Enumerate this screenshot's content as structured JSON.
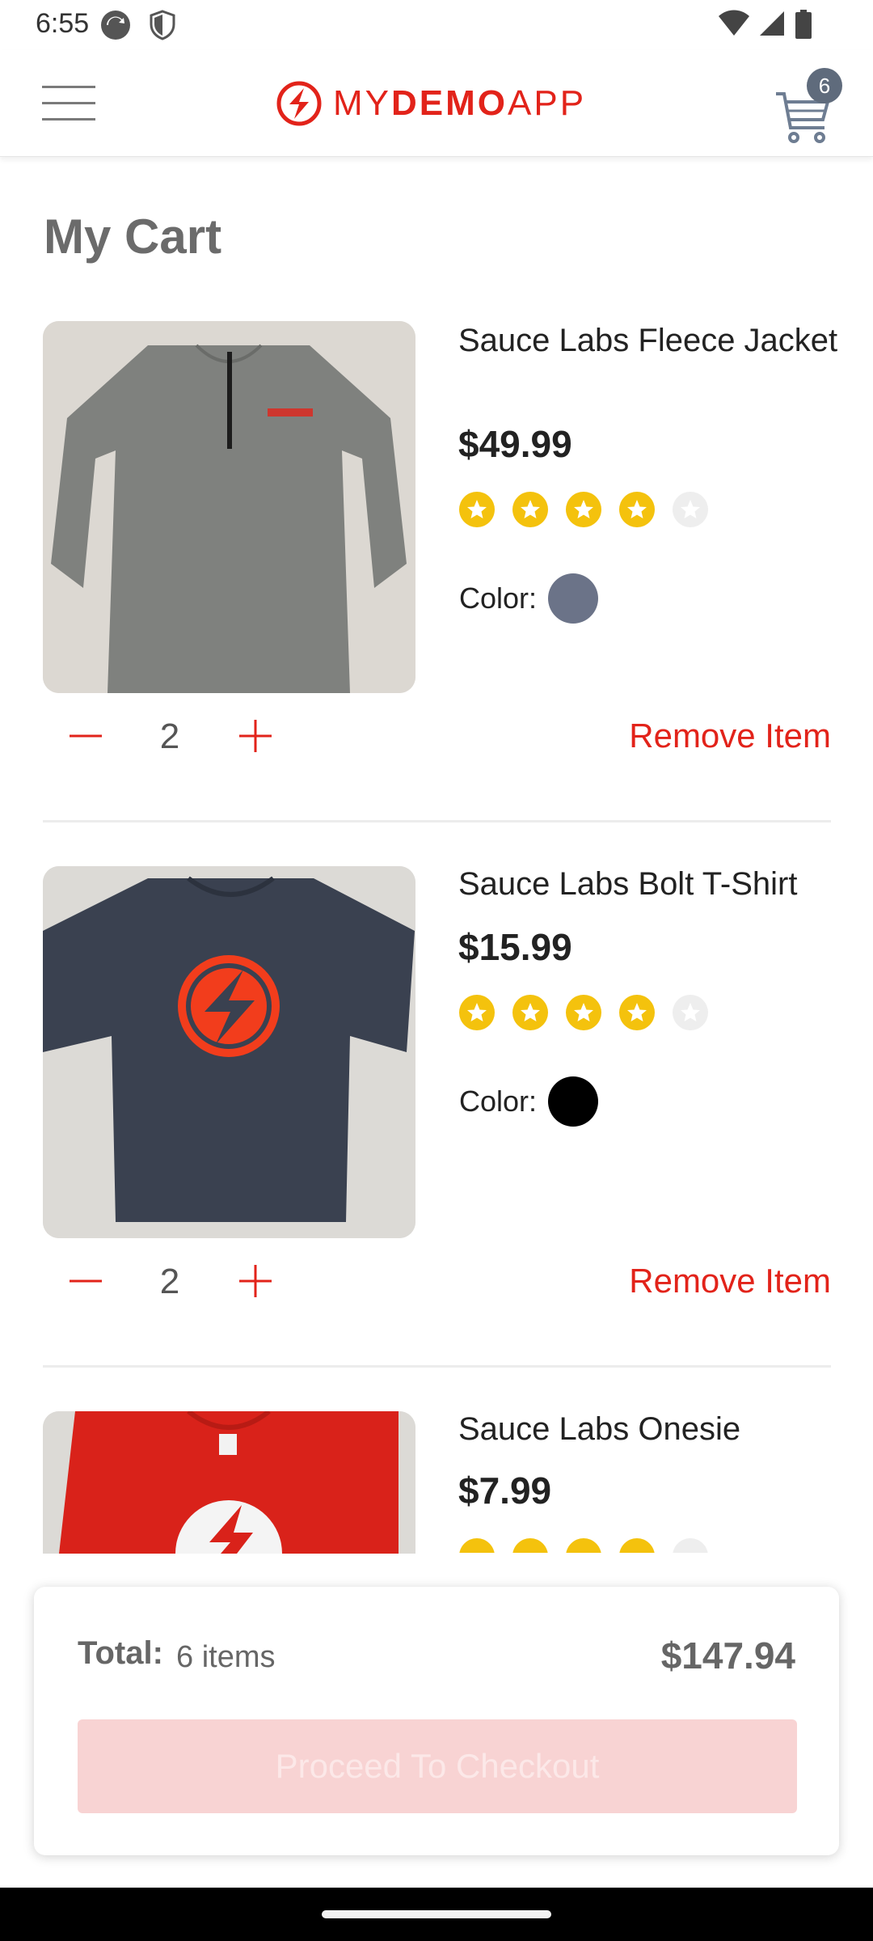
{
  "status_bar": {
    "time": "6:55"
  },
  "header": {
    "logo_my": "MY",
    "logo_demo": "DEMO",
    "logo_app": "APP",
    "cart_count": "6",
    "accent_color": "#e2231a"
  },
  "page": {
    "title": "My Cart"
  },
  "items": [
    {
      "name": "Sauce Labs Fleece Jacket",
      "price": "$49.99",
      "rating": 4,
      "rating_max": 5,
      "color_label": "Color:",
      "color_hex": "#6b7388",
      "quantity": "2",
      "remove_label": "Remove Item"
    },
    {
      "name": "Sauce Labs Bolt T-Shirt",
      "price": "$15.99",
      "rating": 4,
      "rating_max": 5,
      "color_label": "Color:",
      "color_hex": "#000000",
      "quantity": "2",
      "remove_label": "Remove Item"
    },
    {
      "name": "Sauce Labs Onesie",
      "price": "$7.99",
      "rating": 4,
      "rating_max": 5
    }
  ],
  "summary": {
    "total_label": "Total:",
    "items_count": "6 items",
    "total_price": "$147.94",
    "checkout_label": "Proceed To Checkout"
  }
}
